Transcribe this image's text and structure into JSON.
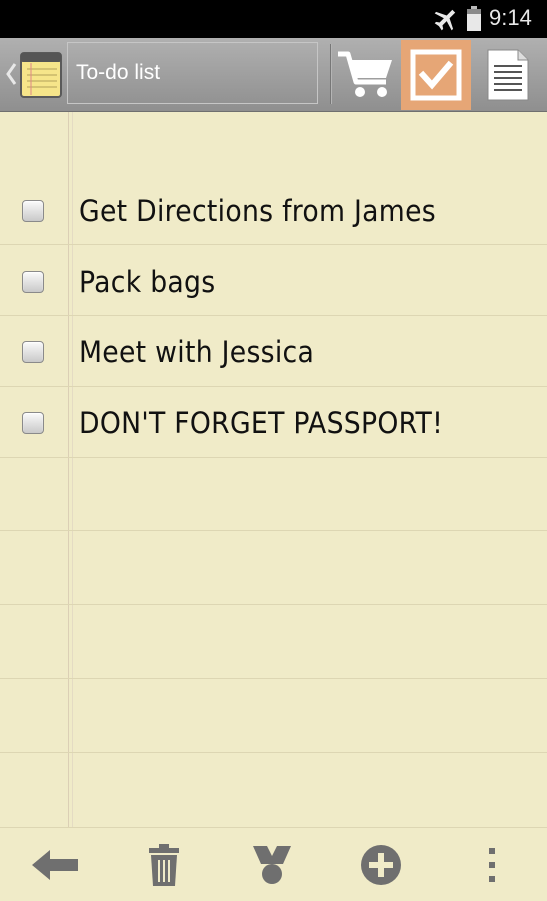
{
  "status_bar": {
    "time": "9:14",
    "icons": [
      "airplane-mode-icon",
      "battery-icon"
    ]
  },
  "action_bar": {
    "title": "To-do list",
    "icons": [
      "up-chevron-icon",
      "notepad-icon",
      "shopping-cart-icon",
      "todo-checkbox-icon",
      "note-document-icon"
    ],
    "selected_tab": "todo",
    "accent_color": "#e6a676"
  },
  "todo_items": [
    {
      "text": "Get Directions from James",
      "checked": false
    },
    {
      "text": "Pack bags",
      "checked": false
    },
    {
      "text": "Meet with Jessica",
      "checked": false
    },
    {
      "text": "DON'T FORGET PASSPORT!",
      "checked": false
    }
  ],
  "bottom_bar": {
    "icons": [
      "back-arrow-icon",
      "trash-icon",
      "share-icon",
      "add-icon",
      "overflow-menu-icon"
    ]
  },
  "colors": {
    "paper": "#f0ebc8",
    "action_bar": "#9a9a9a",
    "status_bar": "#000000"
  }
}
